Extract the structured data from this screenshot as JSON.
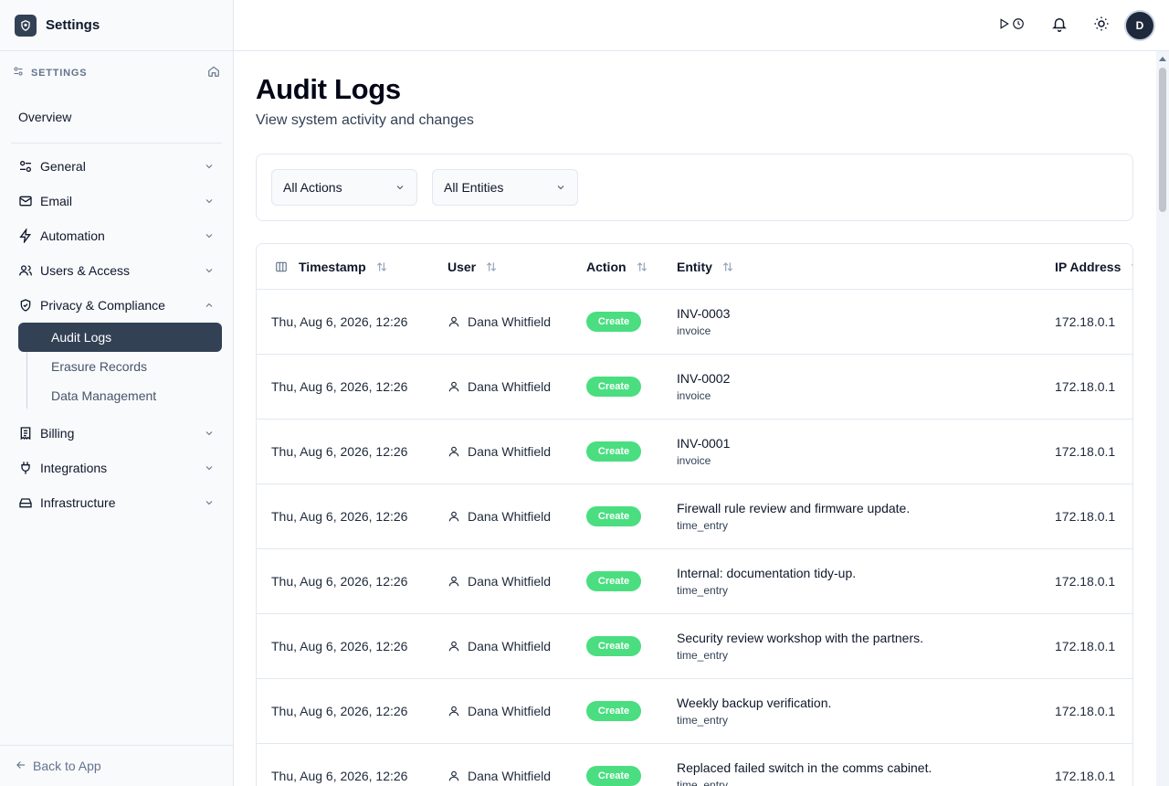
{
  "app": {
    "title": "Settings"
  },
  "sidebar": {
    "section_label": "SETTINGS",
    "overview": "Overview",
    "items": [
      {
        "label": "General",
        "icon": "sliders-icon"
      },
      {
        "label": "Email",
        "icon": "mail-icon"
      },
      {
        "label": "Automation",
        "icon": "lightning-icon"
      },
      {
        "label": "Users & Access",
        "icon": "users-icon"
      },
      {
        "label": "Privacy & Compliance",
        "icon": "shield-icon"
      },
      {
        "label": "Billing",
        "icon": "receipt-icon"
      },
      {
        "label": "Integrations",
        "icon": "plug-icon"
      },
      {
        "label": "Infrastructure",
        "icon": "hard-drive-icon"
      }
    ],
    "sub_items": [
      "Audit Logs",
      "Erasure Records",
      "Data Management"
    ],
    "active_sub_item": "Audit Logs",
    "back": "Back to App"
  },
  "topbar": {
    "avatar_initial": "D"
  },
  "page": {
    "title": "Audit Logs",
    "subtitle": "View system activity and changes"
  },
  "filters": {
    "actions": "All Actions",
    "entities": "All Entities"
  },
  "table": {
    "columns": [
      "Timestamp",
      "User",
      "Action",
      "Entity",
      "IP Address"
    ],
    "rows": [
      {
        "timestamp": "Thu, Aug 6, 2026, 12:26",
        "user": "Dana Whitfield",
        "action": "Create",
        "entity": "INV-0003",
        "entity_type": "invoice",
        "ip": "172.18.0.1"
      },
      {
        "timestamp": "Thu, Aug 6, 2026, 12:26",
        "user": "Dana Whitfield",
        "action": "Create",
        "entity": "INV-0002",
        "entity_type": "invoice",
        "ip": "172.18.0.1"
      },
      {
        "timestamp": "Thu, Aug 6, 2026, 12:26",
        "user": "Dana Whitfield",
        "action": "Create",
        "entity": "INV-0001",
        "entity_type": "invoice",
        "ip": "172.18.0.1"
      },
      {
        "timestamp": "Thu, Aug 6, 2026, 12:26",
        "user": "Dana Whitfield",
        "action": "Create",
        "entity": "Firewall rule review and firmware update.",
        "entity_type": "time_entry",
        "ip": "172.18.0.1"
      },
      {
        "timestamp": "Thu, Aug 6, 2026, 12:26",
        "user": "Dana Whitfield",
        "action": "Create",
        "entity": "Internal: documentation tidy-up.",
        "entity_type": "time_entry",
        "ip": "172.18.0.1"
      },
      {
        "timestamp": "Thu, Aug 6, 2026, 12:26",
        "user": "Dana Whitfield",
        "action": "Create",
        "entity": "Security review workshop with the partners.",
        "entity_type": "time_entry",
        "ip": "172.18.0.1"
      },
      {
        "timestamp": "Thu, Aug 6, 2026, 12:26",
        "user": "Dana Whitfield",
        "action": "Create",
        "entity": "Weekly backup verification.",
        "entity_type": "time_entry",
        "ip": "172.18.0.1"
      },
      {
        "timestamp": "Thu, Aug 6, 2026, 12:26",
        "user": "Dana Whitfield",
        "action": "Create",
        "entity": "Replaced failed switch in the comms cabinet.",
        "entity_type": "time_entry",
        "ip": "172.18.0.1"
      }
    ]
  },
  "colors": {
    "accent": "#334155",
    "badge_create": "#4ade80"
  }
}
